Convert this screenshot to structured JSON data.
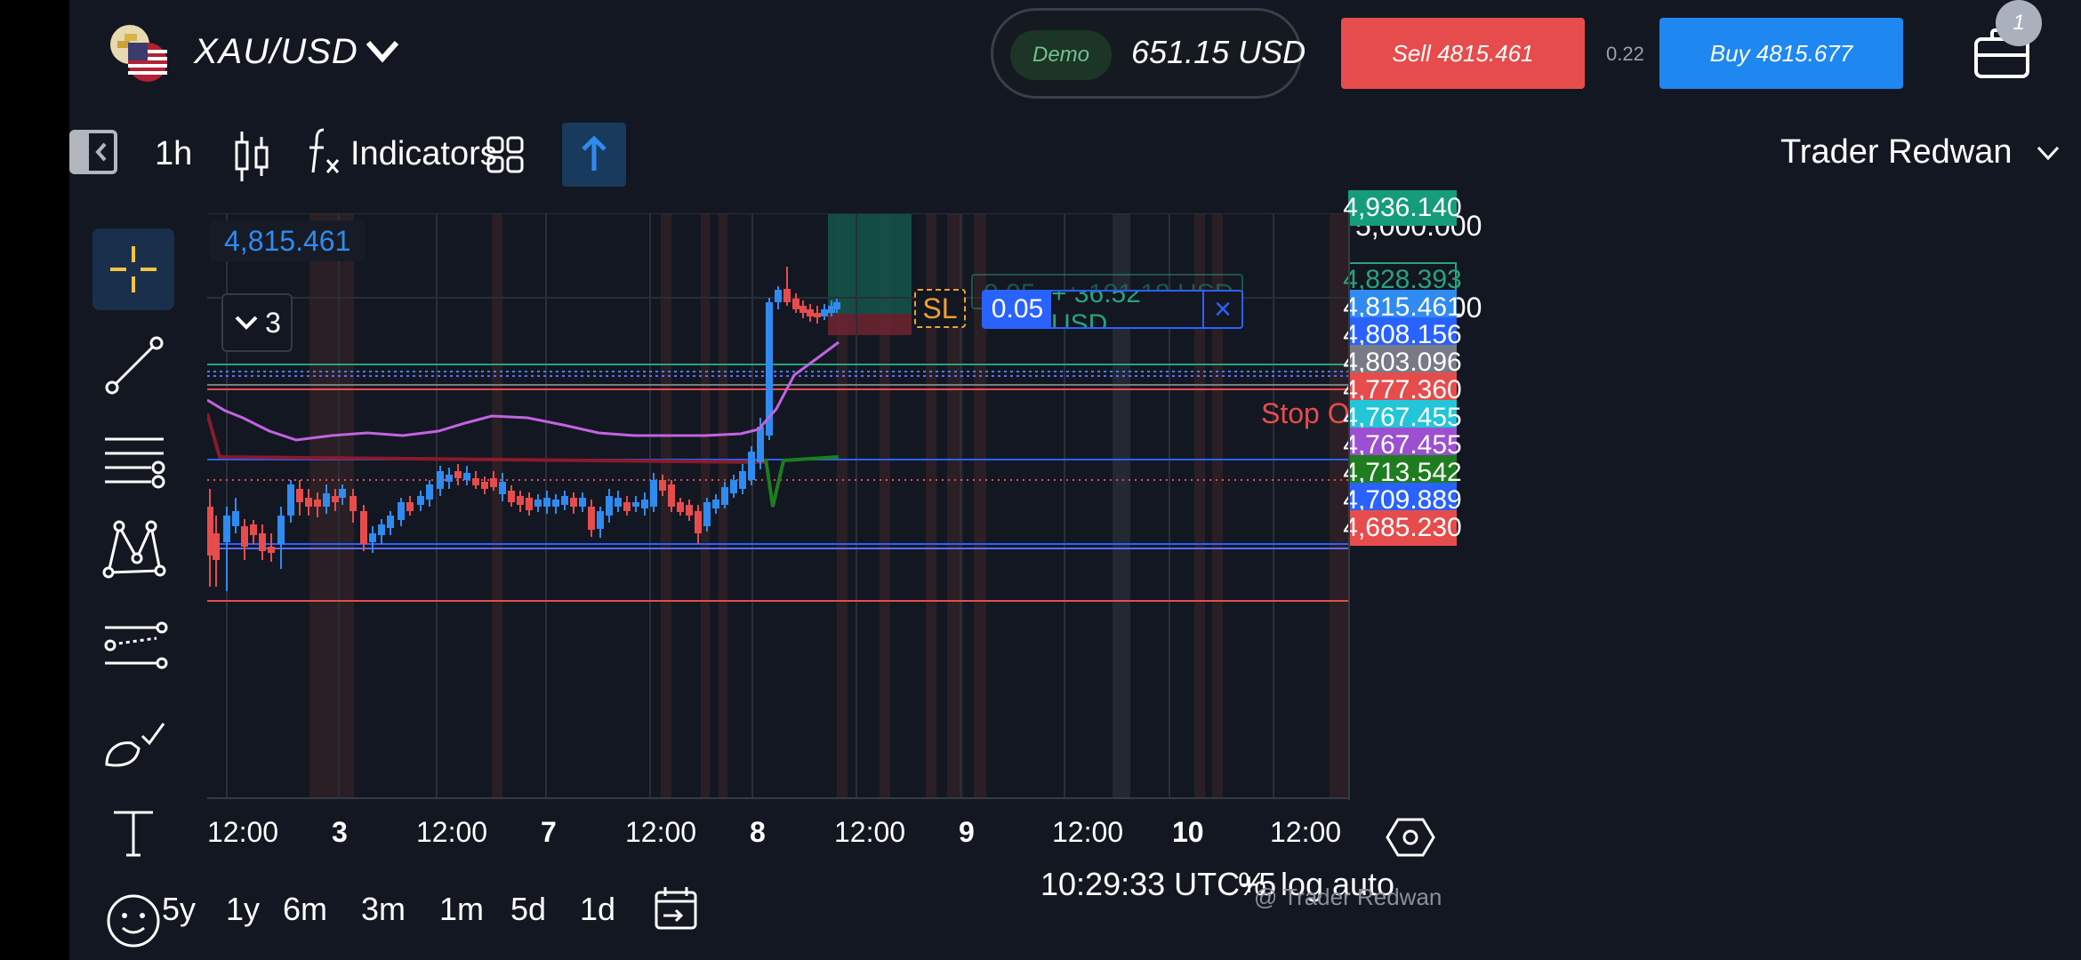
{
  "header": {
    "symbol": "XAU/USD",
    "demo_label": "Demo",
    "balance": "651.15 USD",
    "sell_label": "Sell 4815.461",
    "spread": "0.22",
    "buy_label": "Buy 4815.677",
    "notification_count": "1"
  },
  "toolbar": {
    "interval": "1h",
    "indicators_label": "Indicators",
    "user_name": "Trader Redwan"
  },
  "chart": {
    "crosshair_price": "4,815.461",
    "collapsed_count": "3",
    "sl_label": "SL",
    "position": {
      "qty": "0.05",
      "pnl": "+ 36.52 USD",
      "close": "×"
    },
    "ghost_position": {
      "qty": "0.05",
      "pnl": "+ 101.18 USD"
    },
    "stop_out_label": "Stop Out",
    "price_axis": {
      "plain_ticks": [
        "5,000.000",
        "4,900.000"
      ],
      "labels": [
        {
          "text": "4,936.140",
          "bg": "#159c7b"
        },
        {
          "text": "4,828.393",
          "bg": "#131722",
          "border": "#2aa27a",
          "color": "#2aa27a"
        },
        {
          "text": "4,815.461",
          "bg": "#2f8bf0"
        },
        {
          "text": "4,808.156",
          "bg": "#2962ff"
        },
        {
          "text": "4,803.096",
          "bg": "#787b86"
        },
        {
          "text": "4,777.360",
          "bg": "#e74c4c"
        },
        {
          "text": "4,767.455",
          "bg": "#22c6d8"
        },
        {
          "text": "4,767.455",
          "bg": "#9c4fd0"
        },
        {
          "text": "4,713.542",
          "bg": "#1e7d1e"
        },
        {
          "text": "4,709.889",
          "bg": "#2962ff"
        },
        {
          "text": "4,685.230",
          "bg": "#e74c4c"
        }
      ]
    },
    "time_axis": [
      {
        "text": "12:00",
        "bold": false
      },
      {
        "text": "3",
        "bold": true
      },
      {
        "text": "12:00",
        "bold": false
      },
      {
        "text": "7",
        "bold": true
      },
      {
        "text": "12:00",
        "bold": false
      },
      {
        "text": "8",
        "bold": true
      },
      {
        "text": "12:00",
        "bold": false
      },
      {
        "text": "9",
        "bold": true
      },
      {
        "text": "12:00",
        "bold": false
      },
      {
        "text": "10",
        "bold": true
      },
      {
        "text": "12:00",
        "bold": false
      }
    ]
  },
  "footer": {
    "ranges": [
      "5y",
      "1y",
      "6m",
      "3m",
      "1m",
      "5d",
      "1d"
    ],
    "clock": "10:29:33 UTC+5",
    "percent": "%",
    "log": "log",
    "auto": "auto",
    "watermark": "@ Trader Redwan"
  },
  "colors": {
    "bull": "#2f8bf0",
    "bear": "#e74c4c",
    "ma": "#c264e0",
    "background": "#131722"
  },
  "icons": [
    "flag-icon",
    "chevron-down-icon",
    "briefcase-icon",
    "sidebar-toggle-icon",
    "candles-icon",
    "fx-icon",
    "layout-grid-icon",
    "arrow-up-icon",
    "crosshair-icon",
    "trendline-icon",
    "fib-icon",
    "pattern-icon",
    "brush-icon",
    "text-icon",
    "emoji-icon",
    "date-range-icon",
    "settings-hex-icon"
  ]
}
